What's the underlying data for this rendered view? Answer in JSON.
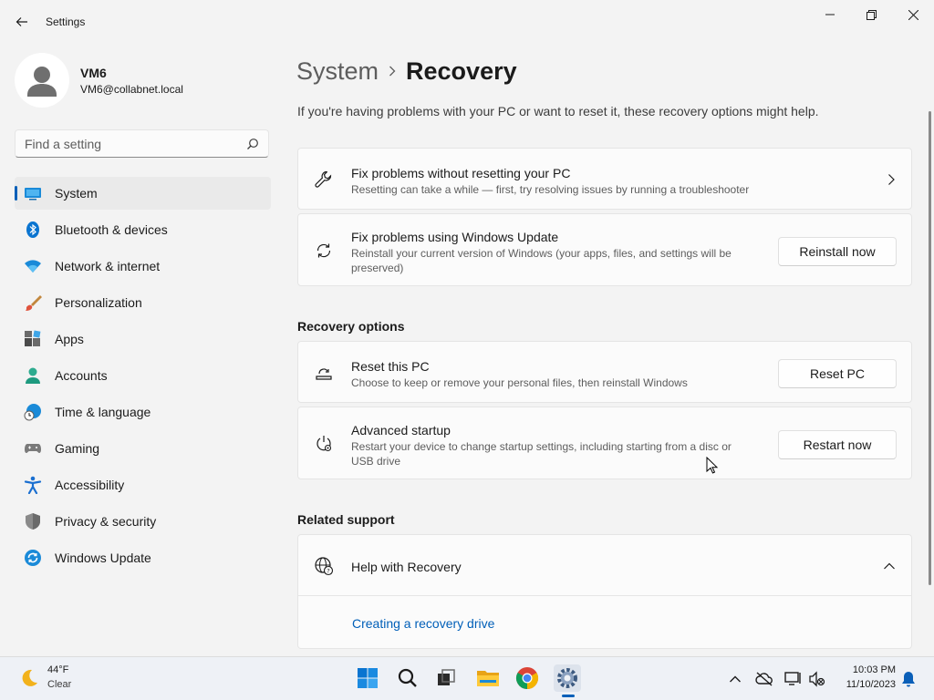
{
  "window": {
    "title": "Settings",
    "back_icon": "arrow-left-icon",
    "minimize_icon": "minimize-icon",
    "maximize_icon": "restore-icon",
    "close_icon": "close-icon"
  },
  "profile": {
    "name": "VM6",
    "email": "VM6@collabnet.local"
  },
  "search": {
    "placeholder": "Find a setting",
    "icon": "search-icon"
  },
  "sidebar": {
    "items": [
      {
        "label": "System",
        "icon": "system-icon",
        "active": true
      },
      {
        "label": "Bluetooth & devices",
        "icon": "bluetooth-icon"
      },
      {
        "label": "Network & internet",
        "icon": "wifi-icon"
      },
      {
        "label": "Personalization",
        "icon": "brush-icon"
      },
      {
        "label": "Apps",
        "icon": "apps-icon"
      },
      {
        "label": "Accounts",
        "icon": "accounts-icon"
      },
      {
        "label": "Time & language",
        "icon": "globe-clock-icon"
      },
      {
        "label": "Gaming",
        "icon": "controller-icon"
      },
      {
        "label": "Accessibility",
        "icon": "accessibility-icon"
      },
      {
        "label": "Privacy & security",
        "icon": "shield-icon"
      },
      {
        "label": "Windows Update",
        "icon": "update-icon"
      }
    ]
  },
  "main": {
    "breadcrumb_parent": "System",
    "breadcrumb_current": "Recovery",
    "description": "If you're having problems with your PC or want to reset it, these recovery options might help.",
    "cards": {
      "fix_no_reset": {
        "title": "Fix problems without resetting your PC",
        "subtitle": "Resetting can take a while — first, try resolving issues by running a troubleshooter"
      },
      "fix_update": {
        "title": "Fix problems using Windows Update",
        "subtitle": "Reinstall your current version of Windows (your apps, files, and settings will be preserved)",
        "button": "Reinstall now"
      }
    },
    "recovery_options_heading": "Recovery options",
    "recovery": {
      "reset": {
        "title": "Reset this PC",
        "subtitle": "Choose to keep or remove your personal files, then reinstall Windows",
        "button": "Reset PC"
      },
      "advanced": {
        "title": "Advanced startup",
        "subtitle": "Restart your device to change startup settings, including starting from a disc or USB drive",
        "button": "Restart now"
      }
    },
    "related_heading": "Related support",
    "help": {
      "title": "Help with Recovery",
      "link": "Creating a recovery drive"
    }
  },
  "taskbar": {
    "weather_temp": "44°F",
    "weather_desc": "Clear",
    "time": "10:03 PM",
    "date": "11/10/2023",
    "apps": [
      "windows-start-icon",
      "search-icon",
      "task-view-icon",
      "file-explorer-icon",
      "chrome-icon",
      "settings-icon"
    ]
  },
  "colors": {
    "accent": "#005fb8",
    "background": "#f3f3f3",
    "card": "#fbfbfb"
  }
}
